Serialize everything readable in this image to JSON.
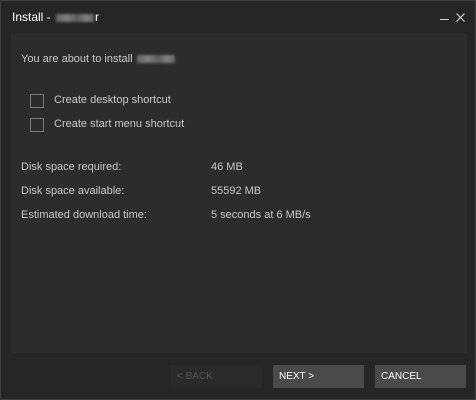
{
  "window": {
    "title_prefix": "Install - ",
    "title_suffix": "r"
  },
  "main": {
    "about_text": "You are about to install",
    "options": [
      {
        "label": "Create desktop shortcut",
        "checked": false
      },
      {
        "label": "Create start menu shortcut",
        "checked": false
      }
    ],
    "info": [
      {
        "label": "Disk space required:",
        "value": "46 MB"
      },
      {
        "label": "Disk space available:",
        "value": "55592 MB"
      },
      {
        "label": "Estimated download time:",
        "value": "5 seconds at 6 MB/s"
      }
    ]
  },
  "buttons": {
    "back": "< BACK",
    "next": "NEXT >",
    "cancel": "CANCEL"
  },
  "icons": {
    "minimize": "minimize-icon",
    "close": "close-icon"
  },
  "colors": {
    "background": "#262627",
    "panel": "#2c2c2d",
    "button": "#4a4a4c",
    "text": "#c9c9c9"
  }
}
